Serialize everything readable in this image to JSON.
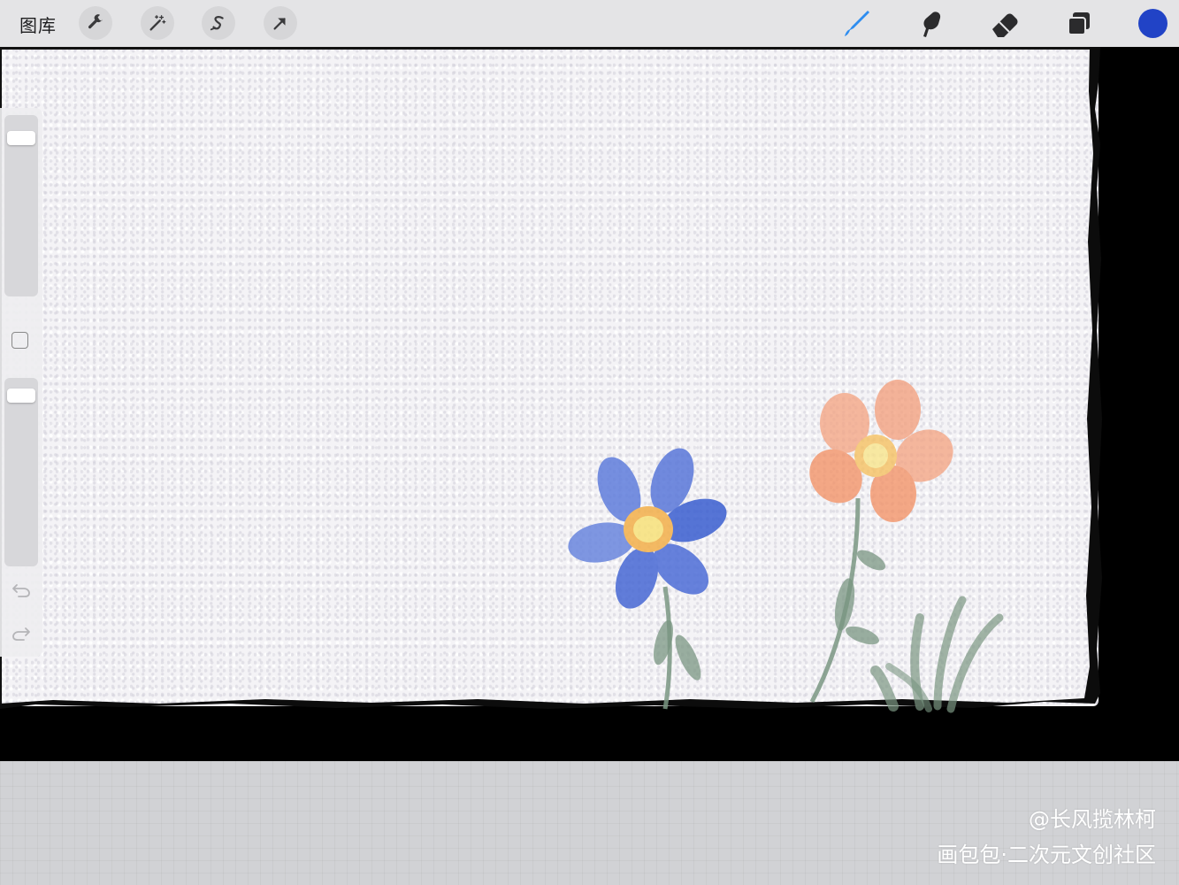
{
  "toolbar": {
    "gallery_label": "图库",
    "left_icons": [
      "wrench-icon",
      "magic-wand-icon",
      "selection-icon",
      "transform-arrow-icon"
    ],
    "right_icons": [
      "brush-icon",
      "smudge-icon",
      "eraser-icon",
      "layers-icon"
    ],
    "active_tool": "brush-icon",
    "accent_color": "#2e8df0",
    "current_color": "#2143c6"
  },
  "sidebar": {
    "icons": [
      "modify-square-icon",
      "undo-icon",
      "redo-icon"
    ]
  },
  "watermark": {
    "author": "@长风揽林柯",
    "site": "画包包·二次元文创社区"
  },
  "colors": {
    "paper": "#f4f3f6",
    "background": "#000000",
    "workspace": "#d1d2d5",
    "blue_flower": "#4a6bd6",
    "orange_flower": "#f29a72",
    "leaves": "#7a9682"
  }
}
